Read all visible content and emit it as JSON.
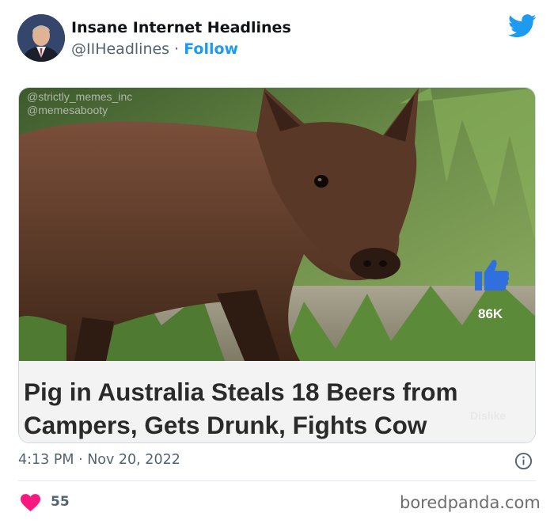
{
  "tweet": {
    "display_name": "Insane Internet Headlines",
    "handle": "@IIHeadlines",
    "separator": " · ",
    "follow_label": "Follow",
    "timestamp": "4:13 PM · Nov 20, 2022",
    "like_count": "55",
    "accent_color": "#1d9bf0",
    "heart_color": "#f91880"
  },
  "media": {
    "watermark_line1": "@strictly_memes_inc",
    "watermark_line2": "@memesabooty",
    "headline_line1": "Pig in Australia Steals 18 Beers from",
    "headline_line2": "Campers, Gets Drunk, Fights Cow",
    "overlay_like_count": "86K",
    "overlay_dislike_label": "Dislike"
  },
  "footer": {
    "brand": "boredpanda.com"
  },
  "icons": {
    "platform": "twitter-bird-icon",
    "info": "info-icon",
    "like": "heart-icon",
    "thumbs_up": "thumbs-up-icon",
    "thumbs_down": "thumbs-down-icon"
  }
}
